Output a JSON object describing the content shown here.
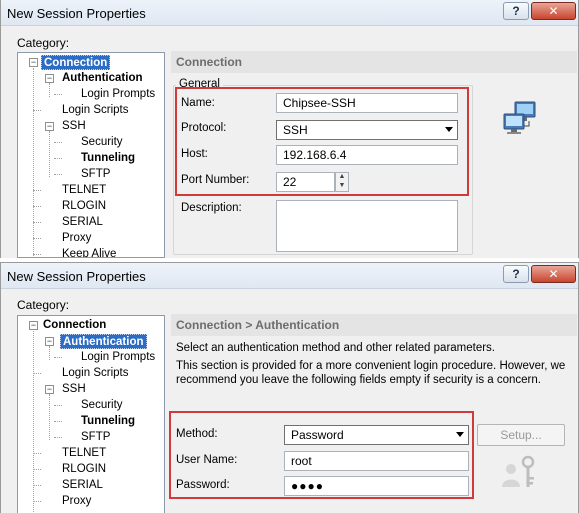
{
  "dialog1": {
    "title": "New Session Properties",
    "help_glyph": "?",
    "close_glyph": "✕",
    "category_label": "Category:",
    "tree": [
      "Connection",
      "Authentication",
      "Login Prompts",
      "Login Scripts",
      "SSH",
      "Security",
      "Tunneling",
      "SFTP",
      "TELNET",
      "RLOGIN",
      "SERIAL",
      "Proxy",
      "Keep Alive"
    ],
    "panel_title": "Connection",
    "group_title": "General",
    "name_label": "Name:",
    "name_value": "Chipsee-SSH",
    "protocol_label": "Protocol:",
    "protocol_value": "SSH",
    "host_label": "Host:",
    "host_value": "192.168.6.4",
    "port_label": "Port Number:",
    "port_value": "22",
    "description_label": "Description:",
    "icon": "network-computers-icon"
  },
  "dialog2": {
    "title": "New Session Properties",
    "help_glyph": "?",
    "close_glyph": "✕",
    "category_label": "Category:",
    "tree": [
      "Connection",
      "Authentication",
      "Login Prompts",
      "Login Scripts",
      "SSH",
      "Security",
      "Tunneling",
      "SFTP",
      "TELNET",
      "RLOGIN",
      "SERIAL",
      "Proxy"
    ],
    "panel_title": "Connection > Authentication",
    "intro_line1": "Select an authentication method and other related parameters.",
    "intro_line2": "This section is provided for a more convenient login procedure. However, we",
    "intro_line3": "recommend you leave the following fields empty if security is a concern.",
    "method_label": "Method:",
    "method_value": "Password",
    "setup_button": "Setup...",
    "username_label": "User Name:",
    "username_value": "root",
    "password_label": "Password:",
    "password_value": "●●●●",
    "icon": "user-key-icon"
  },
  "colors": {
    "highlight_box": "#cf3b3b",
    "tree_selection": "#2b6cc4"
  }
}
